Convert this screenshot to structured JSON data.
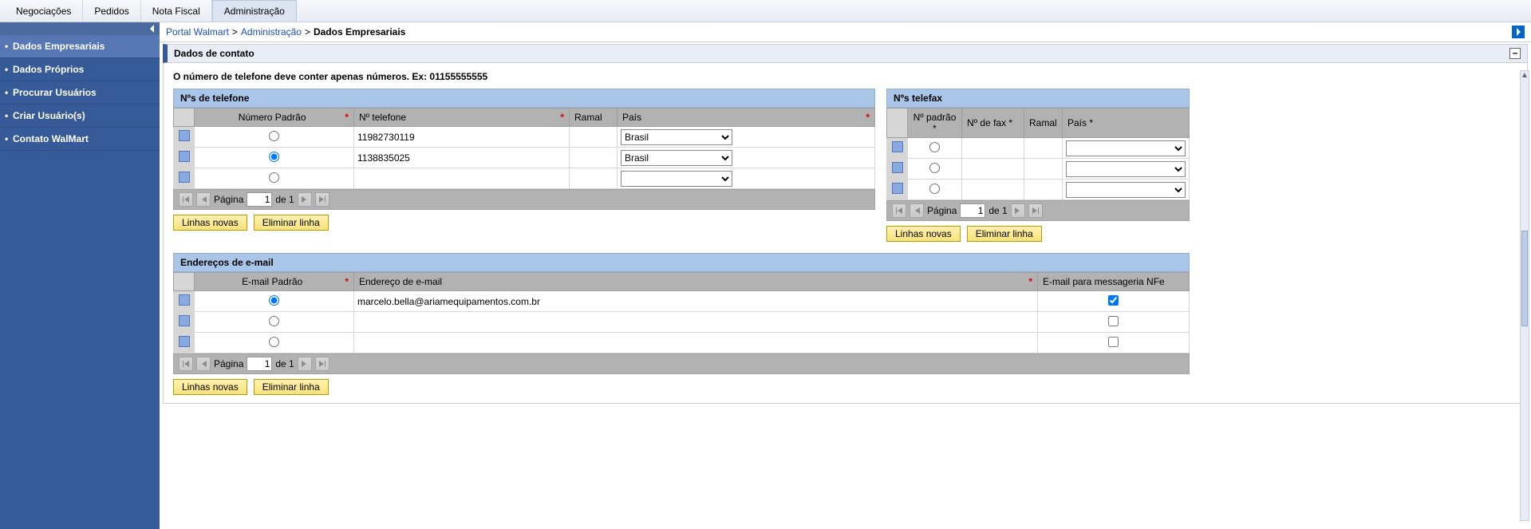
{
  "topnav": {
    "tabs": [
      "Negociações",
      "Pedidos",
      "Nota Fiscal",
      "Administração"
    ],
    "active_index": 3
  },
  "sidebar": {
    "items": [
      {
        "label": "Dados Empresariais"
      },
      {
        "label": "Dados Próprios"
      },
      {
        "label": "Procurar Usuários"
      },
      {
        "label": "Criar Usuário(s)"
      },
      {
        "label": "Contato WalMart"
      }
    ],
    "active_index": 0
  },
  "breadcrumb": {
    "root": "Portal Walmart",
    "mid": "Administração",
    "current": "Dados Empresariais",
    "sep": ">"
  },
  "section": {
    "title": "Dados de contato",
    "hint": "O número de telefone deve conter apenas números. Ex: 01155555555"
  },
  "phone_table": {
    "title": "Nºs de telefone",
    "headers": {
      "numero_padrao": "Número Padrão",
      "telefone": "Nº telefone",
      "ramal": "Ramal",
      "pais": "País"
    },
    "rows": [
      {
        "padrao": false,
        "telefone": "11982730119",
        "ramal": "",
        "pais": "Brasil"
      },
      {
        "padrao": true,
        "telefone": "1138835025",
        "ramal": "",
        "pais": "Brasil"
      },
      {
        "padrao": false,
        "telefone": "",
        "ramal": "",
        "pais": ""
      }
    ],
    "pager": {
      "label_pagina": "Página",
      "page": "1",
      "de": "de 1"
    },
    "buttons": {
      "novas": "Linhas novas",
      "eliminar": "Eliminar linha"
    }
  },
  "fax_table": {
    "title": "Nºs telefax",
    "headers": {
      "padrao": "Nº padrão *",
      "fax": "Nº de fax *",
      "ramal": "Ramal",
      "pais": "País *"
    },
    "rows": [
      {
        "padrao": false,
        "fax": "",
        "ramal": "",
        "pais": ""
      },
      {
        "padrao": false,
        "fax": "",
        "ramal": "",
        "pais": ""
      },
      {
        "padrao": false,
        "fax": "",
        "ramal": "",
        "pais": ""
      }
    ],
    "pager": {
      "label_pagina": "Página",
      "page": "1",
      "de": "de 1"
    },
    "buttons": {
      "novas": "Linhas novas",
      "eliminar": "Eliminar linha"
    }
  },
  "email_table": {
    "title": "Endereços de e-mail",
    "headers": {
      "padrao": "E-mail Padrão",
      "endereco": "Endereço de e-mail",
      "nfe": "E-mail para messageria NFe"
    },
    "rows": [
      {
        "padrao": true,
        "email": "marcelo.bella@ariamequipamentos.com.br",
        "nfe": true
      },
      {
        "padrao": false,
        "email": "",
        "nfe": false
      },
      {
        "padrao": false,
        "email": "",
        "nfe": false
      }
    ],
    "pager": {
      "label_pagina": "Página",
      "page": "1",
      "de": "de 1"
    },
    "buttons": {
      "novas": "Linhas novas",
      "eliminar": "Eliminar linha"
    }
  },
  "pais_options": [
    "",
    "Brasil"
  ]
}
